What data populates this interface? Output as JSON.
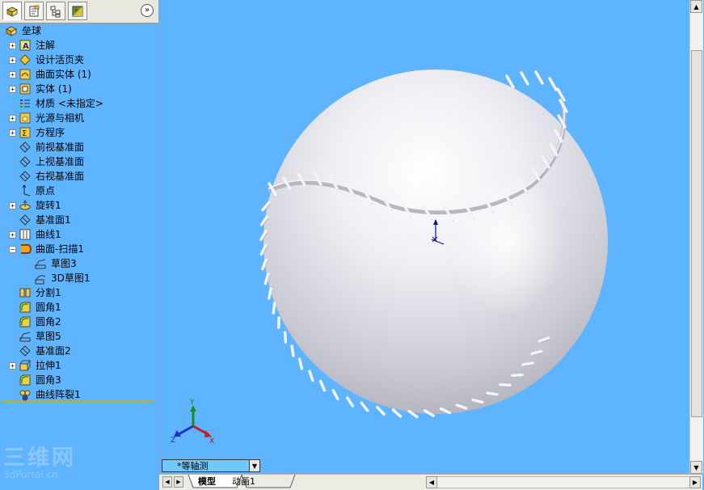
{
  "panel": {
    "tabs": [
      {
        "name": "feature-manager",
        "icon": "feature-tree-icon"
      },
      {
        "name": "property-manager",
        "icon": "property-icon"
      },
      {
        "name": "configuration-manager",
        "icon": "configuration-icon"
      },
      {
        "name": "display-manager",
        "icon": "display-icon"
      }
    ],
    "expand_label": "»"
  },
  "tree": {
    "root": "垒球",
    "items": [
      {
        "label": "注解",
        "icon": "annotation-icon",
        "expandable": true,
        "expanded": false
      },
      {
        "label": "设计活页夹",
        "icon": "design-binder-icon",
        "expandable": true,
        "expanded": false
      },
      {
        "label": "曲面实体 (1)",
        "icon": "surface-bodies-icon",
        "expandable": true,
        "expanded": false
      },
      {
        "label": "实体 (1)",
        "icon": "solid-bodies-icon",
        "expandable": true,
        "expanded": false
      },
      {
        "label": "材质 <未指定>",
        "icon": "material-icon",
        "expandable": false
      },
      {
        "label": "光源与相机",
        "icon": "lights-camera-icon",
        "expandable": true,
        "expanded": false
      },
      {
        "label": "方程序",
        "icon": "equations-icon",
        "expandable": true,
        "expanded": false
      },
      {
        "label": "前视基准面",
        "icon": "plane-icon",
        "expandable": false
      },
      {
        "label": "上视基准面",
        "icon": "plane-icon",
        "expandable": false
      },
      {
        "label": "右视基准面",
        "icon": "plane-icon",
        "expandable": false
      },
      {
        "label": "原点",
        "icon": "origin-icon",
        "expandable": false
      },
      {
        "label": "旋转1",
        "icon": "revolve-icon",
        "expandable": true,
        "expanded": false
      },
      {
        "label": "基准面1",
        "icon": "plane-icon",
        "expandable": false
      },
      {
        "label": "曲线1",
        "icon": "curve-icon",
        "expandable": true,
        "expanded": false
      },
      {
        "label": "曲面-扫描1",
        "icon": "surface-sweep-icon",
        "expandable": true,
        "expanded": true
      },
      {
        "label": "草图3",
        "icon": "sketch-icon",
        "expandable": false,
        "child": true
      },
      {
        "label": "3D草图1",
        "icon": "sketch-3d-icon",
        "expandable": false,
        "child": true
      },
      {
        "label": "分割1",
        "icon": "split-icon",
        "expandable": false
      },
      {
        "label": "圆角1",
        "icon": "fillet-icon",
        "expandable": false
      },
      {
        "label": "圆角2",
        "icon": "fillet-icon",
        "expandable": false
      },
      {
        "label": "草图5",
        "icon": "sketch-icon",
        "expandable": false
      },
      {
        "label": "基准面2",
        "icon": "plane-icon",
        "expandable": false
      },
      {
        "label": "拉伸1",
        "icon": "extrude-icon",
        "expandable": true,
        "expanded": false
      },
      {
        "label": "圆角3",
        "icon": "fillet-icon",
        "expandable": false
      },
      {
        "label": "曲线阵裂1",
        "icon": "curve-pattern-icon",
        "expandable": false
      }
    ]
  },
  "watermark": {
    "big": "三维网",
    "small": "3dPortal.cn"
  },
  "viewport": {
    "orientation": "*等轴测",
    "triad": {
      "y": "Y",
      "z": "Z",
      "x": "X"
    },
    "background_color": "#5fb4ff"
  },
  "bottom_tabs": [
    {
      "label": "模型",
      "active": true
    },
    {
      "label": "动画1",
      "active": false
    }
  ]
}
